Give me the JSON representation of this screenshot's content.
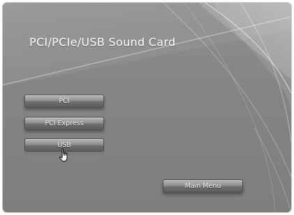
{
  "window": {
    "title": "PCI/PCIe/USB Sound Card"
  },
  "menu": {
    "buttons": [
      {
        "label": "PCI"
      },
      {
        "label": "PCI Express"
      },
      {
        "label": "USB"
      }
    ],
    "main_menu_label": "Main Menu"
  },
  "cursor": {
    "icon": "hand-pointer-icon",
    "hovered_button": "USB"
  },
  "colors": {
    "background": "#858585",
    "text": "#ffffff",
    "button_top": "#b8b8b8",
    "button_bottom": "#5c5c5c"
  }
}
